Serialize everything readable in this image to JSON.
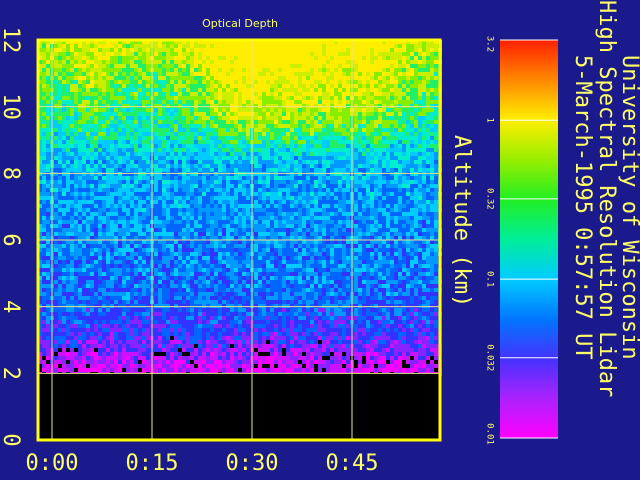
{
  "chart_data": {
    "type": "heatmap",
    "title": "Optical Depth",
    "xlabel": "",
    "ylabel": "Altitude (km)",
    "x_ticks": [
      "0:00",
      "0:15",
      "0:30",
      "0:45"
    ],
    "y_ticks": [
      "0",
      "2",
      "4",
      "6",
      "8",
      "10",
      "12"
    ],
    "ylim": [
      0,
      12
    ],
    "grid": true,
    "colorbar": {
      "scale": "log",
      "range": [
        0.01,
        3.2
      ],
      "ticks": [
        "3.2",
        "1",
        "0.32",
        "0.1",
        "0.032",
        "0.01"
      ]
    },
    "no_data_below_km": 2,
    "header": {
      "line1": "University of Wisconsin",
      "line2": "High Spectral Resolution Lidar",
      "line3": "5-March-1995   0:57:57 UT"
    }
  },
  "colors": {
    "background": "#1a1a8c",
    "text": "#ffff66",
    "axis_frame": "#ffff00",
    "grid": "#e6e68c"
  }
}
